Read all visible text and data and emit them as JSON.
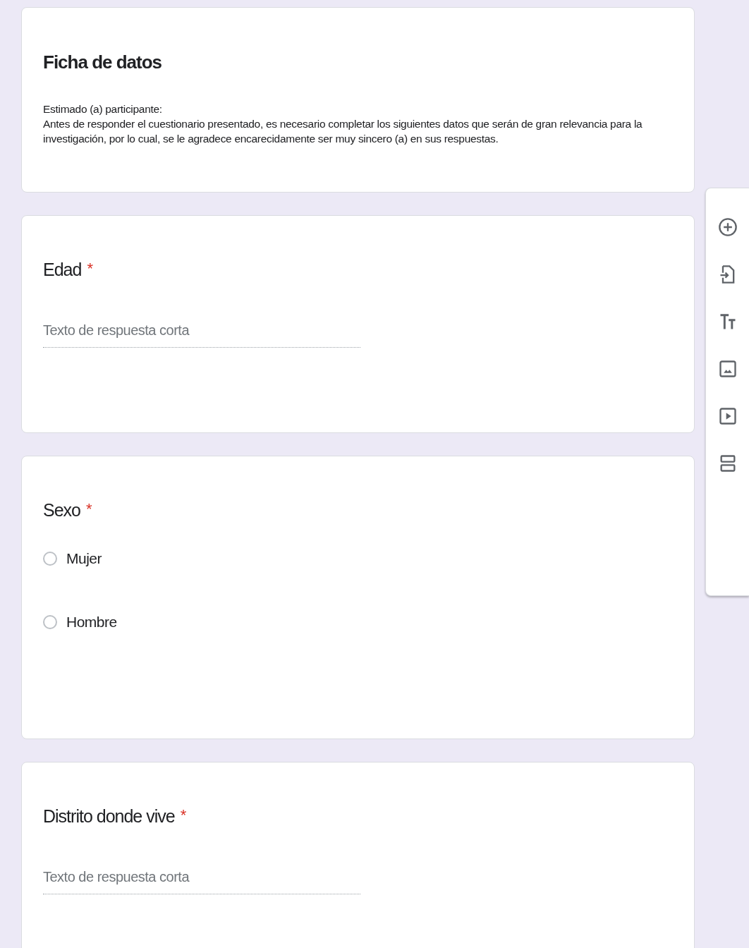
{
  "header": {
    "title": "Ficha de datos",
    "paragraphs": [
      "Estimado (a) participante:",
      "Antes de responder el cuestionario presentado, es necesario completar los siguientes datos que serán de gran relevancia para la investigación, por lo cual, se le agradece encarecidamente ser muy sincero (a) en sus respuestas."
    ]
  },
  "questions": [
    {
      "kind": "short_answer",
      "title": "Edad",
      "required": true,
      "required_mark": "*",
      "placeholder": "Texto de respuesta corta"
    },
    {
      "kind": "multiple_choice",
      "title": "Sexo",
      "required": true,
      "required_mark": "*",
      "options": [
        {
          "label": "Mujer",
          "selected": false
        },
        {
          "label": "Hombre",
          "selected": false
        }
      ]
    },
    {
      "kind": "short_answer",
      "title": "Distrito donde vive",
      "required": true,
      "required_mark": "*",
      "placeholder": "Texto de respuesta corta"
    }
  ]
}
